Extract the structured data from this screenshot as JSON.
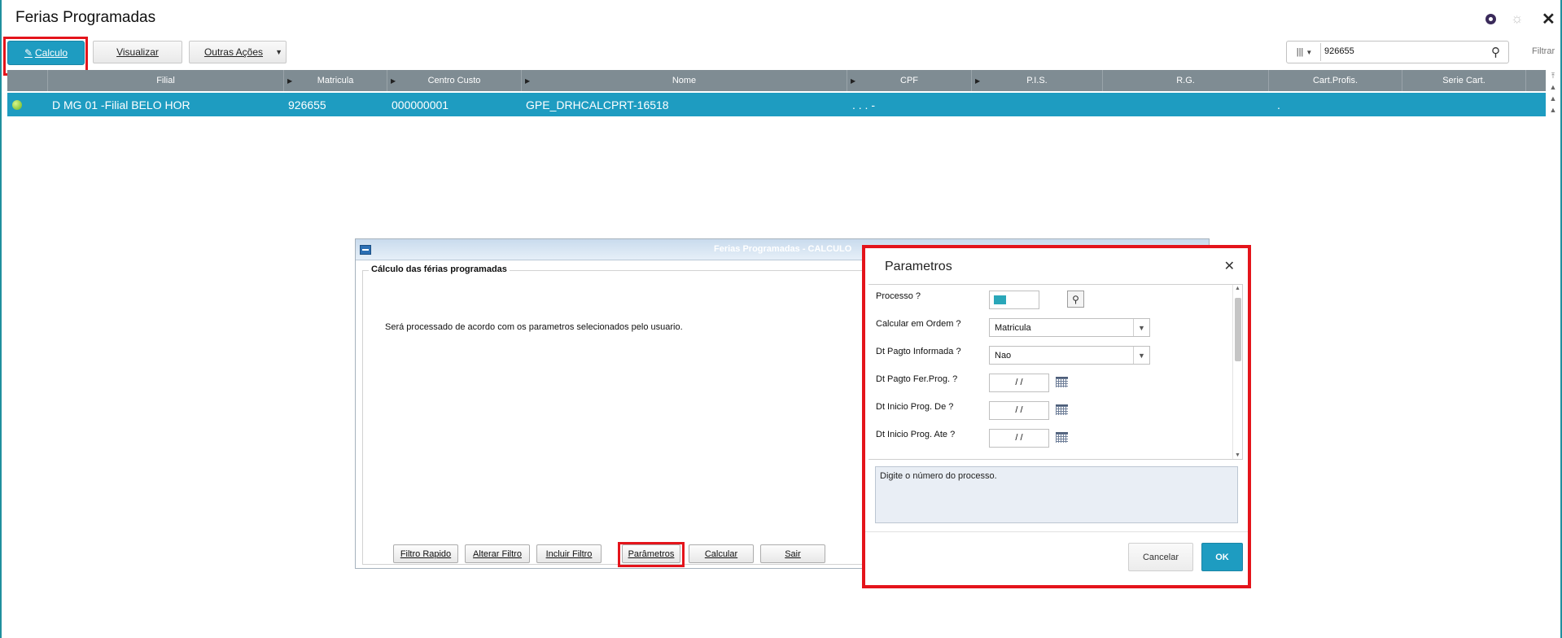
{
  "app": {
    "title": "Ferias Programadas"
  },
  "header_icons": {
    "logo": "totvs-logo-icon",
    "settings": "gear-icon",
    "close": "close-icon",
    "close_glyph": "✕",
    "settings_glyph": "☼"
  },
  "toolbar": {
    "calculo_label": "Calculo",
    "calculo_icon": "✎",
    "visualizar_label": "Visualizar",
    "outras_label": "Outras Ações",
    "search_value": "926655",
    "search_cols_glyph": "|||",
    "filtrar_label": "Filtrar"
  },
  "grid": {
    "columns": [
      "Filial",
      "Matricula",
      "Centro Custo",
      "Nome",
      "CPF",
      "P.I.S.",
      "R.G.",
      "Cart.Profis.",
      "Serie Cart."
    ],
    "row": {
      "filial": "D MG 01 -Filial BELO HOR",
      "matricula": "926655",
      "centro_custo": "000000001",
      "nome": "GPE_DRHCALCPRT-16518",
      "cpf": ". . . -",
      "cart_profis": "."
    }
  },
  "bg_dialog": {
    "title": "Ferias Programadas - CALCULO",
    "group_label": "Cálculo das férias programadas",
    "message": "Será processado de acordo com os parametros selecionados pelo usuario.",
    "buttons": [
      "Filtro Rapido",
      "Alterar Filtro",
      "Incluir Filtro",
      "Parâmetros",
      "Calcular",
      "Sair"
    ]
  },
  "param_modal": {
    "title": "Parametros",
    "fields": [
      {
        "label": "Processo ?",
        "value": ""
      },
      {
        "label": "Calcular em Ordem ?",
        "value": "Matricula"
      },
      {
        "label": "Dt Pagto Informada ?",
        "value": "Nao"
      },
      {
        "label": "Dt Pagto Fer.Prog. ?",
        "value": " /  /"
      },
      {
        "label": "Dt Inicio Prog. De ?",
        "value": " /  /"
      },
      {
        "label": "Dt Inicio Prog. Ate ?",
        "value": " /  /"
      }
    ],
    "help_text": "Digite o número do processo.",
    "cancel_label": "Cancelar",
    "ok_label": "OK"
  },
  "colors": {
    "accent": "#1e9cc1",
    "highlight": "#e4141b",
    "grid_header": "#7f8c93"
  }
}
